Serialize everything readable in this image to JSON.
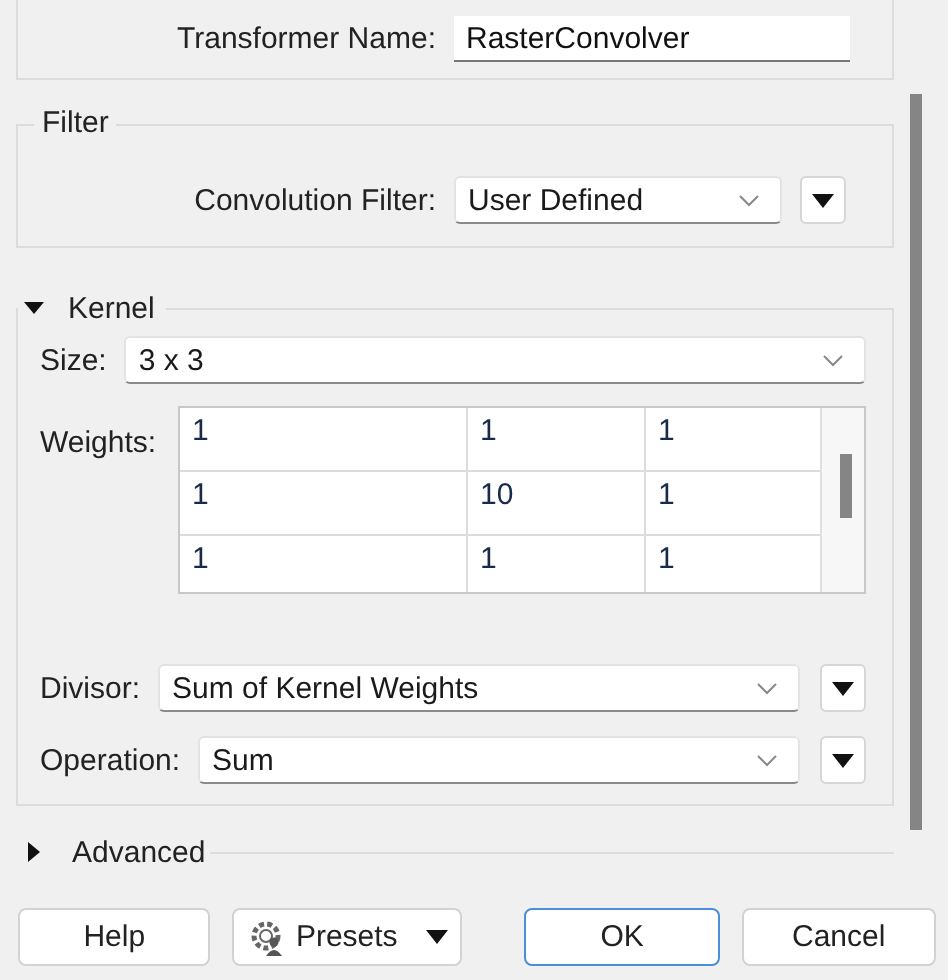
{
  "transformer_name": {
    "label": "Transformer Name:",
    "value": "RasterConvolver"
  },
  "filter": {
    "title": "Filter",
    "convolution_filter": {
      "label": "Convolution Filter:",
      "value": "User Defined"
    }
  },
  "kernel": {
    "title": "Kernel",
    "expanded": true,
    "size": {
      "label": "Size:",
      "value": "3 x 3"
    },
    "weights": {
      "label": "Weights:",
      "rows": [
        [
          "1",
          "1",
          "1"
        ],
        [
          "1",
          "10",
          "1"
        ],
        [
          "1",
          "1",
          "1"
        ]
      ]
    },
    "divisor": {
      "label": "Divisor:",
      "value": "Sum of Kernel Weights"
    },
    "operation": {
      "label": "Operation:",
      "value": "Sum"
    }
  },
  "advanced": {
    "title": "Advanced",
    "expanded": false
  },
  "buttons": [
    {
      "label": "Help",
      "kind": "plain"
    },
    {
      "label": "Presets",
      "kind": "menu"
    },
    {
      "label": "OK",
      "kind": "default"
    },
    {
      "label": "Cancel",
      "kind": "plain"
    }
  ]
}
